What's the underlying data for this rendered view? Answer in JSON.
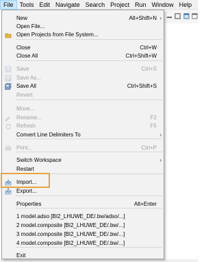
{
  "menubar": {
    "items": [
      "File",
      "Tools",
      "Edit",
      "Navigate",
      "Search",
      "Project",
      "Run",
      "Window",
      "Help"
    ],
    "active_index": 0
  },
  "file_menu": {
    "items": [
      {
        "label": "New",
        "shortcut": "Alt+Shift+N",
        "submenu": true,
        "enabled": true,
        "icon": ""
      },
      {
        "label": "Open File...",
        "shortcut": "",
        "submenu": false,
        "enabled": true,
        "icon": ""
      },
      {
        "label": "Open Projects from File System...",
        "shortcut": "",
        "submenu": false,
        "enabled": true,
        "icon": "folder-icon"
      },
      {
        "label": "Close",
        "shortcut": "Ctrl+W",
        "submenu": false,
        "enabled": true,
        "icon": ""
      },
      {
        "label": "Close All",
        "shortcut": "Ctrl+Shift+W",
        "submenu": false,
        "enabled": true,
        "icon": ""
      },
      {
        "label": "Save",
        "shortcut": "Ctrl+S",
        "submenu": false,
        "enabled": false,
        "icon": "save-icon"
      },
      {
        "label": "Save As...",
        "shortcut": "",
        "submenu": false,
        "enabled": false,
        "icon": "save-as-icon"
      },
      {
        "label": "Save All",
        "shortcut": "Ctrl+Shift+S",
        "submenu": false,
        "enabled": true,
        "icon": "save-all-icon"
      },
      {
        "label": "Revert",
        "shortcut": "",
        "submenu": false,
        "enabled": false,
        "icon": ""
      },
      {
        "label": "Move...",
        "shortcut": "",
        "submenu": false,
        "enabled": false,
        "icon": ""
      },
      {
        "label": "Rename...",
        "shortcut": "F2",
        "submenu": false,
        "enabled": false,
        "icon": "rename-icon"
      },
      {
        "label": "Refresh",
        "shortcut": "F5",
        "submenu": false,
        "enabled": false,
        "icon": "refresh-icon"
      },
      {
        "label": "Convert Line Delimiters To",
        "shortcut": "",
        "submenu": true,
        "enabled": true,
        "icon": ""
      },
      {
        "label": "Print...",
        "shortcut": "Ctrl+P",
        "submenu": false,
        "enabled": false,
        "icon": "print-icon"
      },
      {
        "label": "Switch Workspace",
        "shortcut": "",
        "submenu": true,
        "enabled": true,
        "icon": ""
      },
      {
        "label": "Restart",
        "shortcut": "",
        "submenu": false,
        "enabled": true,
        "icon": ""
      },
      {
        "label": "Import...",
        "shortcut": "",
        "submenu": false,
        "enabled": true,
        "icon": "import-icon"
      },
      {
        "label": "Export...",
        "shortcut": "",
        "submenu": false,
        "enabled": true,
        "icon": "export-icon"
      },
      {
        "label": "Properties",
        "shortcut": "Alt+Enter",
        "submenu": false,
        "enabled": true,
        "icon": ""
      },
      {
        "label": "1 model.adso  [BI2_LHUWE_DE/.bw/adso/...]",
        "shortcut": "",
        "submenu": false,
        "enabled": true,
        "icon": ""
      },
      {
        "label": "2 model.composite  [BI2_LHUWE_DE/.bw/...]",
        "shortcut": "",
        "submenu": false,
        "enabled": true,
        "icon": ""
      },
      {
        "label": "3 model.composite  [BI2_LHUWE_DE/.bw/...]",
        "shortcut": "",
        "submenu": false,
        "enabled": true,
        "icon": ""
      },
      {
        "label": "4 model.composite  [BI2_LHUWE_DE/.bw/...]",
        "shortcut": "",
        "submenu": false,
        "enabled": true,
        "icon": ""
      },
      {
        "label": "Exit",
        "shortcut": "",
        "submenu": false,
        "enabled": true,
        "icon": ""
      }
    ],
    "highlighted_item": "Import..."
  },
  "colors": {
    "highlight_border": "#e8a33d",
    "menubar_active": "#cce8ff",
    "disabled_text": "#a0a0a0"
  }
}
